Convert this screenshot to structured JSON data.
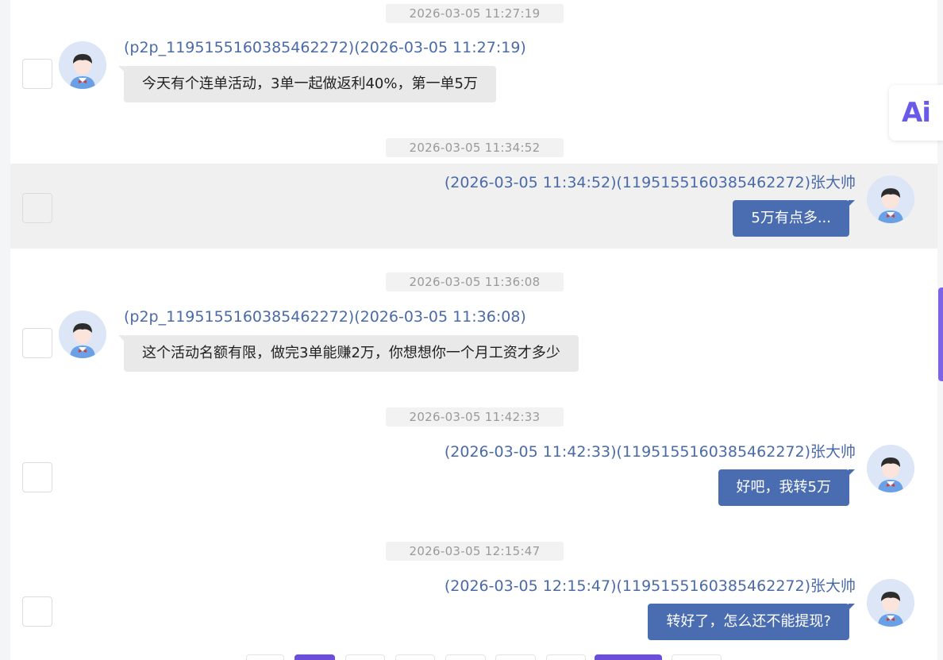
{
  "badges": {
    "ai_label": "Ai"
  },
  "messages": [
    {
      "timestamp": "2026-03-05 11:27:19",
      "direction": "incoming",
      "meta": "(p2p_1195155160385462272)(2026-03-05 11:27:19)",
      "text": "今天有个连单活动，3单一起做返利40%，第一单5万"
    },
    {
      "timestamp": "2026-03-05 11:34:52",
      "direction": "outgoing",
      "meta": "(2026-03-05 11:34:52)(1195155160385462272)张大帅",
      "text": "5万有点多..."
    },
    {
      "timestamp": "2026-03-05 11:36:08",
      "direction": "incoming",
      "meta": "(p2p_1195155160385462272)(2026-03-05 11:36:08)",
      "text": "这个活动名额有限，做完3单能赚2万，你想想你一个月工资才多少"
    },
    {
      "timestamp": "2026-03-05 11:42:33",
      "direction": "outgoing",
      "meta": "(2026-03-05 11:42:33)(1195155160385462272)张大帅",
      "text": "好吧，我转5万"
    },
    {
      "timestamp": "2026-03-05 12:15:47",
      "direction": "outgoing",
      "meta": "(2026-03-05 12:15:47)(1195155160385462272)张大帅",
      "text": "转好了，怎么还不能提现?"
    }
  ],
  "colors": {
    "incoming_bubble": "#e9e9e9",
    "outgoing_bubble": "#4a6cb0",
    "meta_text": "#4a6aa8",
    "accent": "#6b4fd8"
  }
}
